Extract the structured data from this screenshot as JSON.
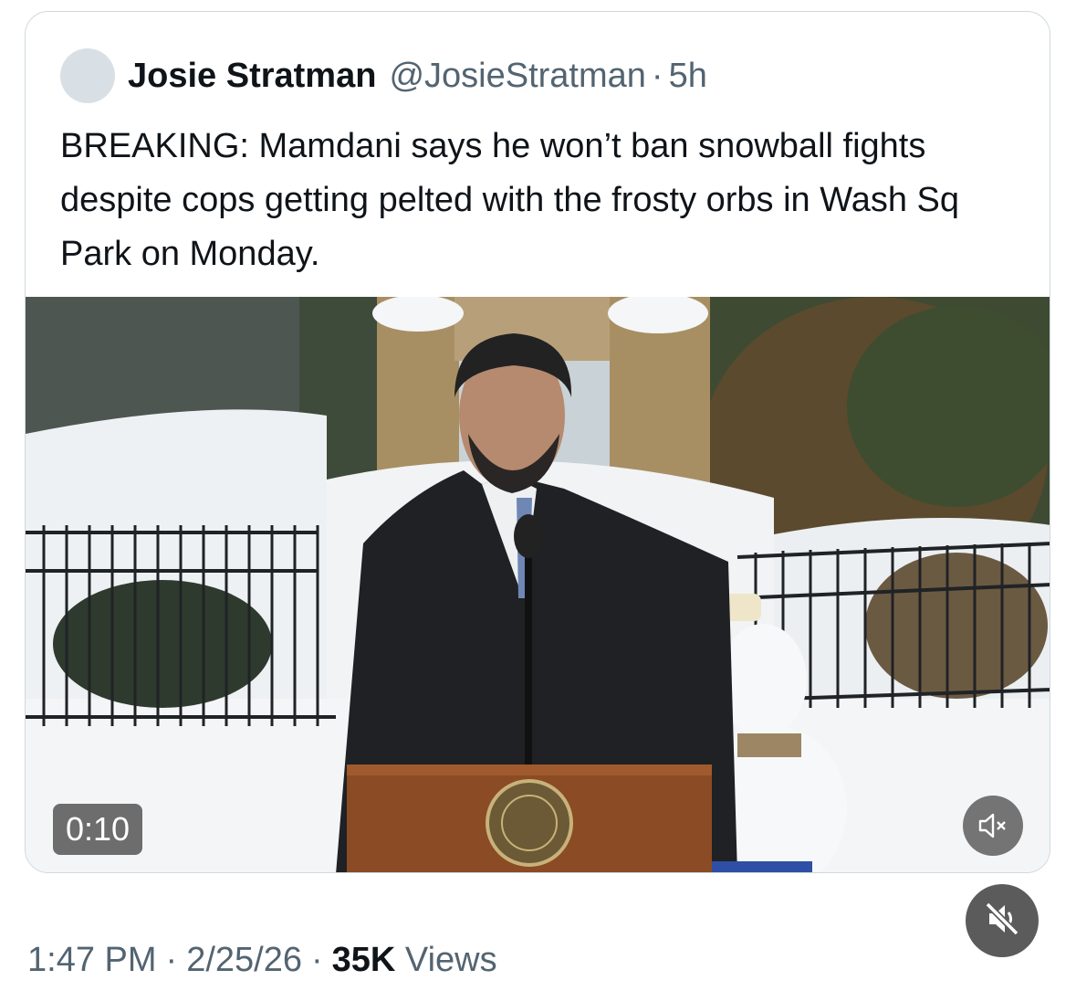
{
  "tweet": {
    "author_name": "Josie Stratman",
    "author_handle": "@JosieStratman",
    "separator": "·",
    "relative_time": "5h",
    "text": "BREAKING: Mamdani says he won’t ban snowball fights despite cops getting pelted with the frosty orbs in Wash Sq Park on Monday.",
    "video": {
      "duration": "0:10",
      "mute_icon": "speaker-muted-icon"
    }
  },
  "footer": {
    "time": "1:47 PM",
    "date": "2/25/26",
    "separator": "·",
    "views_count": "35K",
    "views_label": "Views",
    "mute_icon": "speaker-off-icon"
  },
  "colors": {
    "text_primary": "#0f1419",
    "text_secondary": "#536471",
    "border": "#cfd9de"
  }
}
